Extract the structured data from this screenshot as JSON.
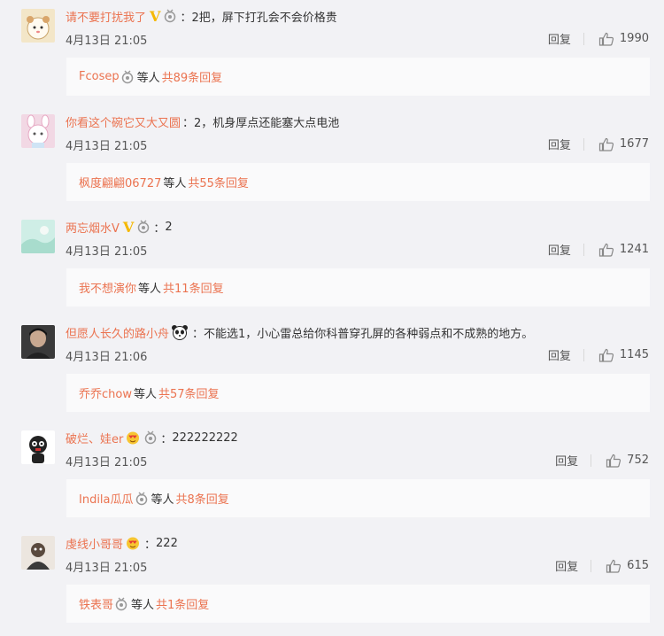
{
  "comments": [
    {
      "username": "请不要打扰我了",
      "verified": "V",
      "text": "2把，屏下打孔会不会价格贵",
      "time": "4月13日 21:05",
      "reply_label": "回复",
      "likes": "1990",
      "replies": {
        "user": "Fcosep",
        "etc": "等人",
        "total": "共89条回复"
      }
    },
    {
      "username": "你看这个碗它又大又圆",
      "text": "2，机身厚点还能塞大点电池",
      "time": "4月13日 21:05",
      "reply_label": "回复",
      "likes": "1677",
      "replies": {
        "user": "枫度翩翩06727",
        "etc": "等人",
        "total": "共55条回复"
      }
    },
    {
      "username": "两忘烟水V",
      "verified": "V",
      "text": "2",
      "time": "4月13日 21:05",
      "reply_label": "回复",
      "likes": "1241",
      "replies": {
        "user": "我不想演你",
        "etc": "等人",
        "total": "共11条回复"
      }
    },
    {
      "username": "但愿人长久的路小舟",
      "text": "不能选1，小心雷总给你科普穿孔屏的各种弱点和不成熟的地方。",
      "time": "4月13日 21:06",
      "reply_label": "回复",
      "likes": "1145",
      "replies": {
        "user": "乔乔chow",
        "etc": "等人",
        "total": "共57条回复"
      }
    },
    {
      "username": "破烂、娃er",
      "text": "222222222",
      "time": "4月13日 21:05",
      "reply_label": "回复",
      "likes": "752",
      "replies": {
        "user": "Indila瓜瓜",
        "etc": "等人",
        "total": "共8条回复"
      }
    },
    {
      "username": "虔线小哥哥",
      "text": "222",
      "time": "4月13日 21:05",
      "reply_label": "回复",
      "likes": "615",
      "replies": {
        "user": "铁表哥",
        "etc": "等人",
        "total": "共1条回复"
      }
    }
  ],
  "colors": {
    "link": "#eb7350",
    "badge_gold": "#f5b800",
    "background": "#f2f2f5",
    "reply_box": "#fafafb"
  },
  "icons": [
    "medal-icon",
    "thumb-up-icon",
    "panda-icon",
    "heart-eyes-emoji-icon"
  ]
}
